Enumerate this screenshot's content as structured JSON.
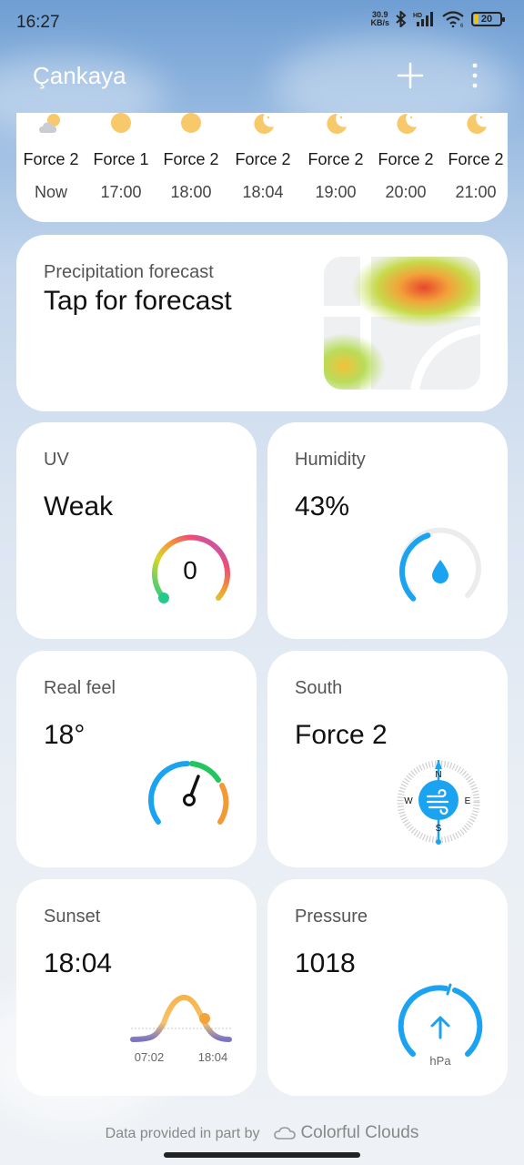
{
  "status_bar": {
    "time": "16:27",
    "net_speed_value": "30.9",
    "net_speed_unit": "KB/s",
    "battery_level": "20",
    "battery_color": "#f2c200"
  },
  "header": {
    "city": "Çankaya",
    "add_icon": "plus-icon",
    "menu_icon": "more-vertical-icon"
  },
  "hourly": [
    {
      "icon": "partly-cloudy-day-icon",
      "force": "Force 2",
      "time": "Now"
    },
    {
      "icon": "sunny-icon",
      "force": "Force 1",
      "time": "17:00"
    },
    {
      "icon": "sunny-icon",
      "force": "Force 2",
      "time": "18:00"
    },
    {
      "icon": "clear-night-icon",
      "force": "Force 2",
      "time": "18:04"
    },
    {
      "icon": "clear-night-icon",
      "force": "Force 2",
      "time": "19:00"
    },
    {
      "icon": "clear-night-icon",
      "force": "Force 2",
      "time": "20:00"
    },
    {
      "icon": "clear-night-icon",
      "force": "Force 2",
      "time": "21:00"
    }
  ],
  "precipitation": {
    "label": "Precipitation forecast",
    "value": "Tap for forecast"
  },
  "uv": {
    "label": "UV",
    "value": "Weak",
    "index": "0"
  },
  "humidity": {
    "label": "Humidity",
    "value": "43%",
    "fraction": 0.43,
    "accent": "#1aa3f0"
  },
  "real_feel": {
    "label": "Real feel",
    "value": "18°"
  },
  "wind": {
    "label": "South",
    "value": "Force 2",
    "compass": {
      "n": "N",
      "s": "S",
      "e": "E",
      "w": "W"
    }
  },
  "sunset": {
    "label": "Sunset",
    "value": "18:04",
    "sunrise_time": "07:02",
    "sunset_time": "18:04"
  },
  "pressure": {
    "label": "Pressure",
    "value": "1018",
    "unit": "hPa",
    "accent": "#1aa3f0"
  },
  "footer": {
    "prefix": "Data provided in part by",
    "brand": "Colorful Clouds"
  }
}
